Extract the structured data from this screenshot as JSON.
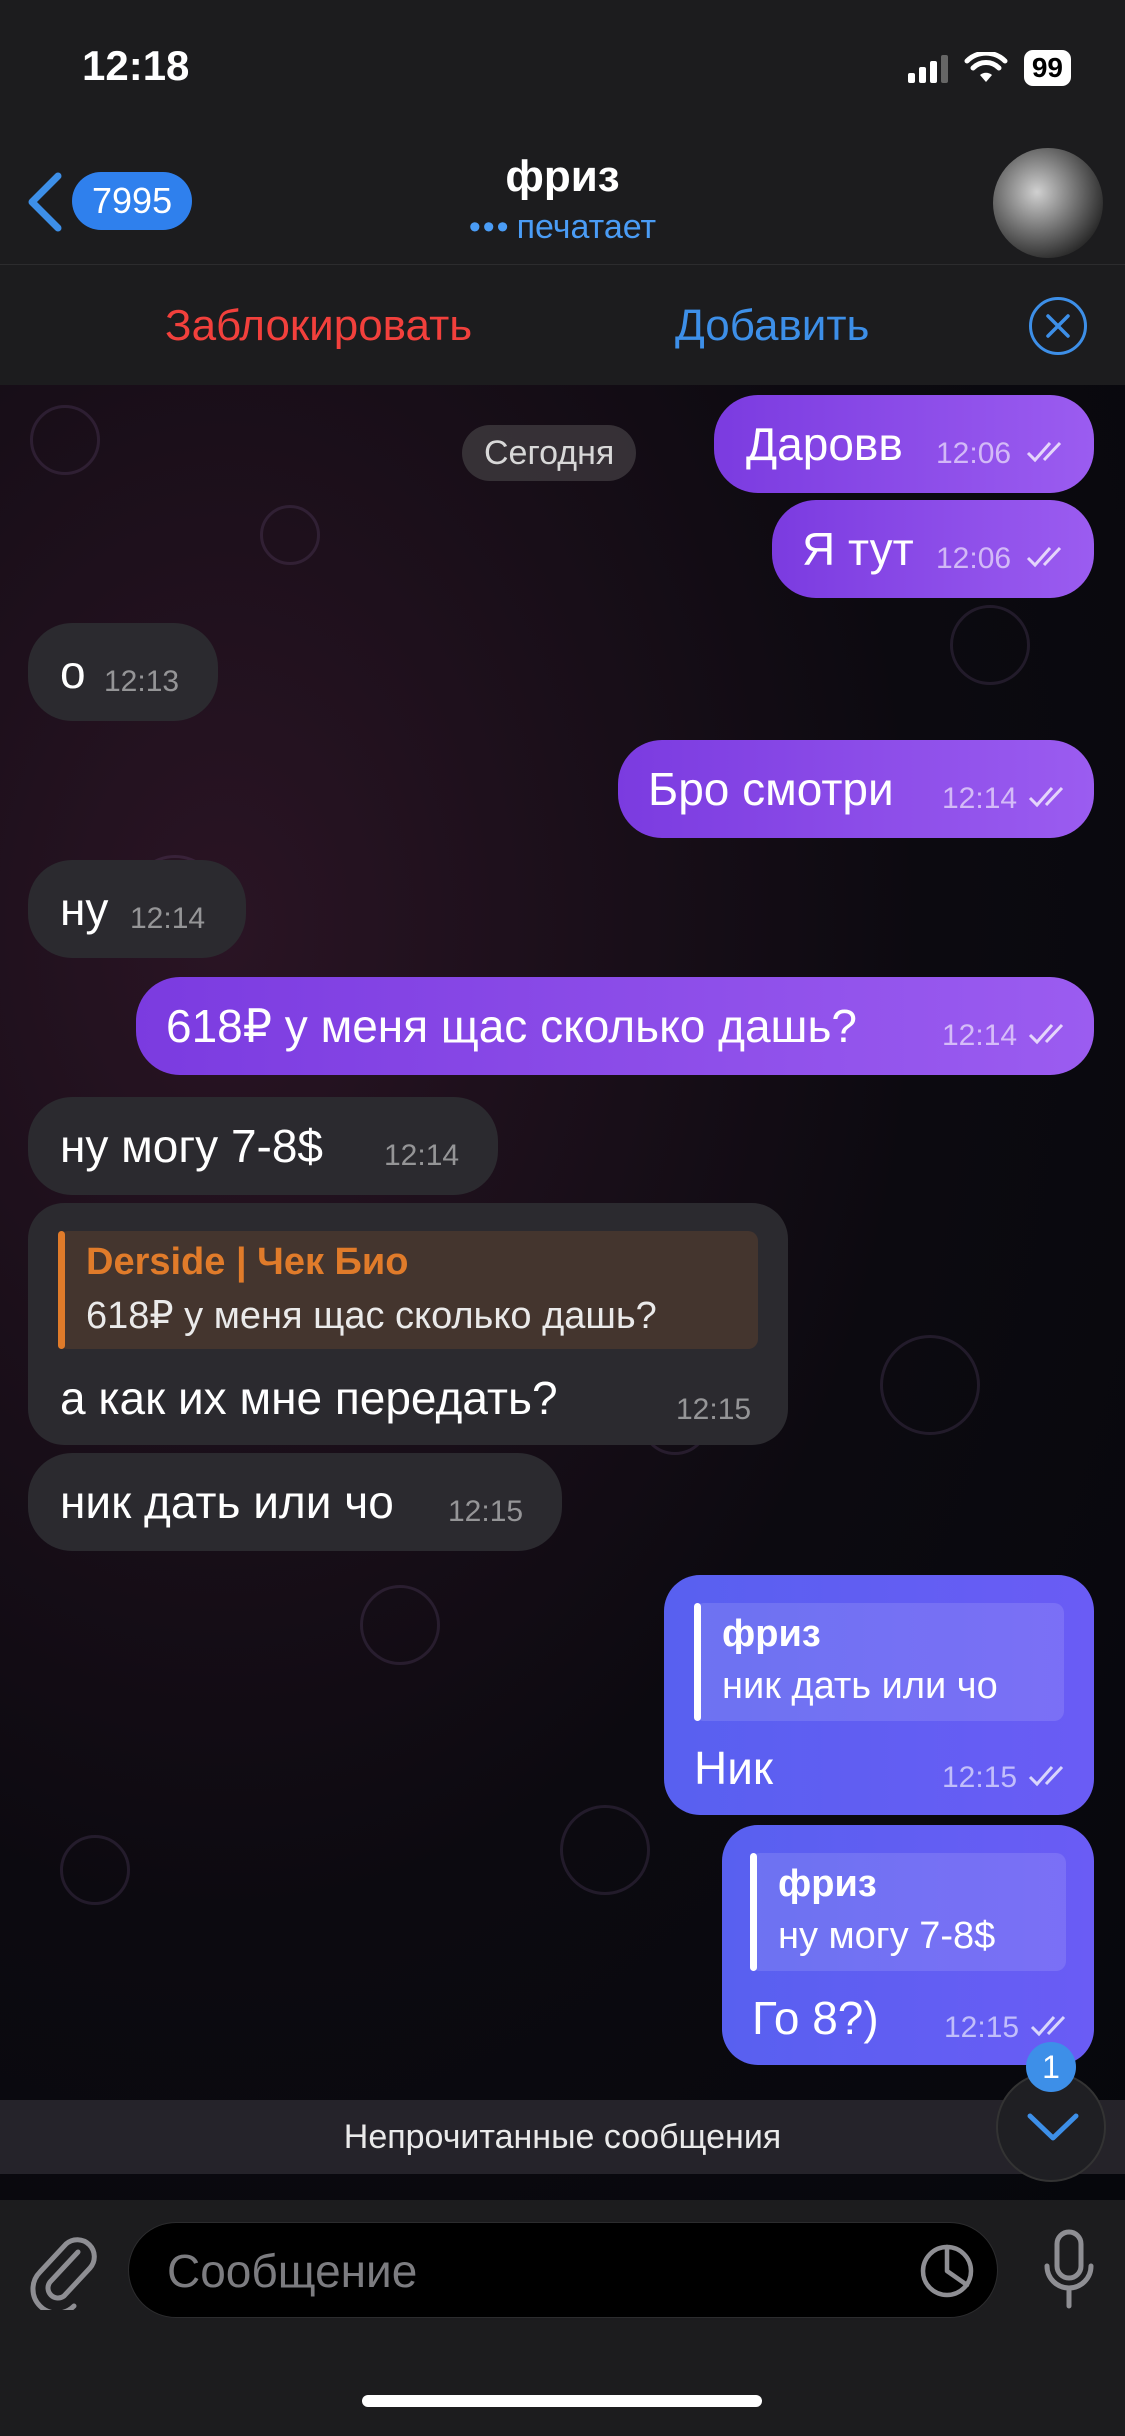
{
  "status_bar": {
    "time": "12:18",
    "battery": "99"
  },
  "header": {
    "back_count": "7995",
    "title": "фриз",
    "status": "печатает",
    "status_dots": "•••"
  },
  "actions": {
    "block": "Заблокировать",
    "add": "Добавить"
  },
  "chat": {
    "date": "Сегодня",
    "messages": [
      {
        "dir": "out",
        "text": "Даровв",
        "time": "12:06"
      },
      {
        "dir": "out",
        "text": "Я тут",
        "time": "12:06"
      },
      {
        "dir": "in",
        "text": "о",
        "time": "12:13"
      },
      {
        "dir": "out",
        "text": "Бро смотри",
        "time": "12:14"
      },
      {
        "dir": "in",
        "text": "ну",
        "time": "12:14"
      },
      {
        "dir": "out",
        "text": "618₽ у меня щас сколько дашь?",
        "time": "12:14"
      },
      {
        "dir": "in",
        "text": "ну могу 7-8$",
        "time": "12:14"
      },
      {
        "dir": "in",
        "text": "а как их мне передать?",
        "time": "12:15",
        "reply": {
          "name": "Derside | Чек Био",
          "text": "618₽ у меня щас сколько дашь?"
        }
      },
      {
        "dir": "in",
        "text": "ник дать или чо",
        "time": "12:15"
      },
      {
        "dir": "out",
        "text": "Ник",
        "time": "12:15",
        "reply": {
          "name": "фриз",
          "text": "ник дать или чо"
        }
      },
      {
        "dir": "out",
        "text": "Го 8?)",
        "time": "12:15",
        "reply": {
          "name": "фриз",
          "text": "ну могу 7-8$"
        }
      }
    ]
  },
  "unread": {
    "label": "Непрочитанные сообщения",
    "count": "1"
  },
  "input": {
    "placeholder": "Сообщение"
  },
  "colors": {
    "accent": "#3d8fe8",
    "outgoing": "#8a4cf0",
    "incoming": "#2b2a2f",
    "block": "#f2403c",
    "quote_orange": "#e07b2a"
  },
  "icons": [
    "back-chevron-icon",
    "close-icon",
    "double-check-icon",
    "paperclip-icon",
    "sticker-icon",
    "microphone-icon",
    "chevron-down-icon"
  ]
}
